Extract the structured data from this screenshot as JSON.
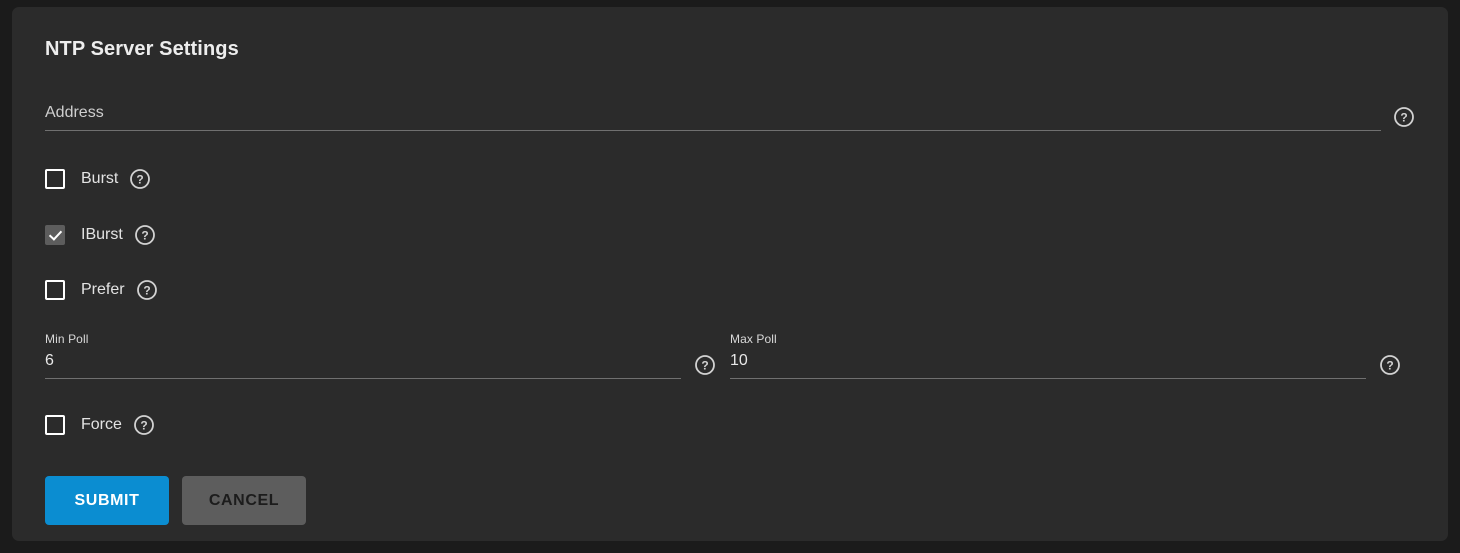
{
  "card": {
    "title": "NTP Server Settings"
  },
  "address_field": {
    "placeholder": "Address",
    "value": "",
    "help_icon": "help-circle-icon"
  },
  "checkboxes": [
    {
      "label": "Burst",
      "checked": false,
      "help_icon": "help-circle-icon"
    },
    {
      "label": "IBurst",
      "checked": true,
      "help_icon": "help-circle-icon"
    },
    {
      "label": "Prefer",
      "checked": false,
      "help_icon": "help-circle-icon"
    }
  ],
  "poll": {
    "min": {
      "label": "Min Poll",
      "value": "6",
      "help_icon": "help-circle-icon"
    },
    "max": {
      "label": "Max Poll",
      "value": "10",
      "help_icon": "help-circle-icon"
    }
  },
  "force": {
    "label": "Force",
    "checked": false,
    "help_icon": "help-circle-icon"
  },
  "buttons": {
    "submit": "SUBMIT",
    "cancel": "CANCEL"
  },
  "colors": {
    "page_background": "#1b1b1b",
    "card_background": "#2b2b2b",
    "accent_submit": "#0b8dd1",
    "cancel_background": "#5d5d5d",
    "checkbox_checked": "#5d5d5d",
    "text_primary": "#e8e8e8",
    "underline": "#707070"
  }
}
